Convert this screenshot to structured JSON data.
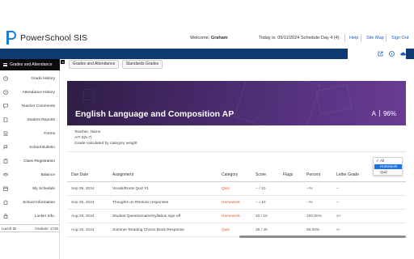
{
  "header": {
    "app_name": "PowerSchool SIS",
    "welcome_prefix": "Welcome,",
    "user_name": "Graham",
    "today": "Today is: 09/11/2024",
    "schedule": "Schedule:",
    "day": "Day 4 (4)",
    "help": "Help",
    "site_map": "Site Map",
    "sign_out": "Sign Out"
  },
  "tray_icons": [
    "external-link-icon",
    "info-icon",
    "cloud-icon"
  ],
  "sidebar": {
    "active": "Grades and Attendance",
    "items": [
      {
        "icon": "clock-icon",
        "label": "Grade History"
      },
      {
        "icon": "clock-icon",
        "label": "Attendance History"
      },
      {
        "icon": "chat-icon",
        "label": "Teacher Comments"
      },
      {
        "icon": "document-icon",
        "label": "Student Reports"
      },
      {
        "icon": "document-icon",
        "label": "Forms"
      },
      {
        "icon": "flag-icon",
        "label": "School Bulletin"
      },
      {
        "icon": "clipboard-icon",
        "label": "Class Registration"
      },
      {
        "icon": "scale-icon",
        "label": "Balance"
      },
      {
        "icon": "calendar-icon",
        "label": "My Schedule"
      },
      {
        "icon": "school-icon",
        "label": "School Information"
      },
      {
        "icon": "lock-icon",
        "label": "Locker Info."
      }
    ],
    "lunch_label": "Lunch ID",
    "lunch_value": "Graham: 1735"
  },
  "tabs": [
    "Grades and Attendance",
    "Standards Grades"
  ],
  "course": {
    "title": "English Language and Composition AP",
    "letter": "A",
    "percent": "96%",
    "teacher": "Teacher, Name",
    "section": "AIT-3(5-7)",
    "calc": "Grade calculated by category weight"
  },
  "filter": {
    "options": [
      "All",
      "Homework",
      "Quiz"
    ],
    "checked": "All",
    "highlighted": "Homework"
  },
  "table": {
    "headers": [
      "Due Date",
      "Assignment",
      "Category",
      "Score",
      "Flags",
      "Percent",
      "Letter Grade"
    ],
    "rows": [
      {
        "due": "Sep 09, 2024",
        "assignment": "Vocab/Roots Quiz #1",
        "category": "Quiz",
        "score": "-- / 10",
        "flags": "",
        "percent": "--%",
        "letter": "--"
      },
      {
        "due": "Sep 05, 2024",
        "assignment": "Thoughts on Rhetoric responses",
        "category": "Homework",
        "score": "-- / 10",
        "flags": "",
        "percent": "--%",
        "letter": "--"
      },
      {
        "due": "Aug 29, 2024",
        "assignment": "Student Questionnaire/Syllabus sign-off",
        "category": "Homework",
        "score": "10 / 10",
        "flags": "",
        "percent": "100.00%",
        "letter": "A+"
      },
      {
        "due": "Aug 26, 2024",
        "assignment": "Summer Reading Choice Book Response",
        "category": "Quiz",
        "score": "36 / 40",
        "flags": "",
        "percent": "90.00%",
        "letter": "A-"
      }
    ]
  }
}
